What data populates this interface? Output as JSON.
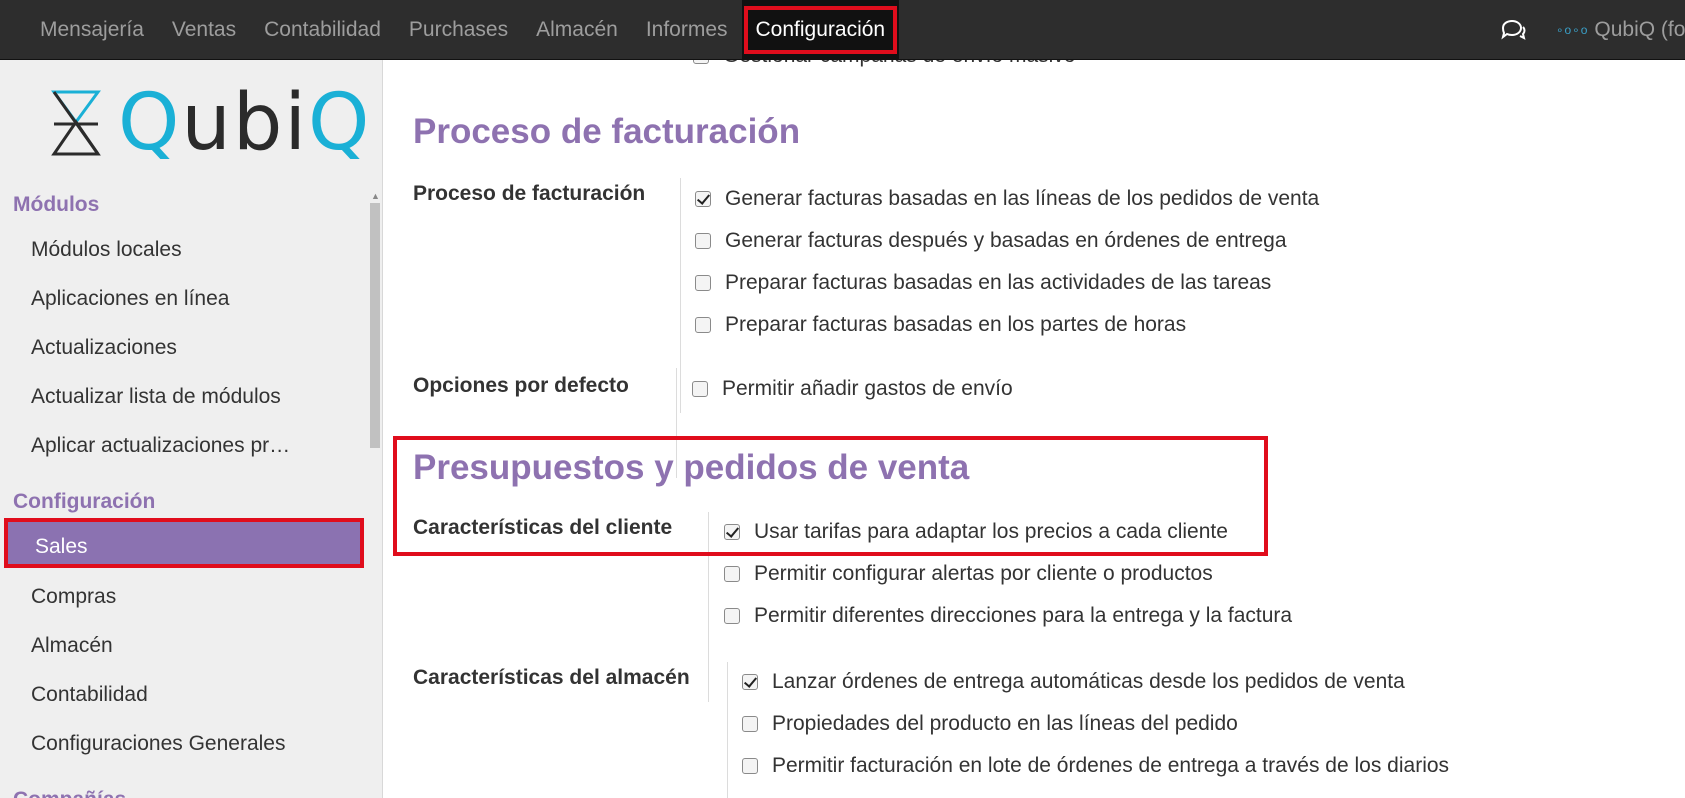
{
  "topbar": {
    "menu": [
      "Mensajería",
      "Ventas",
      "Contabilidad",
      "Purchases",
      "Almacén",
      "Informes",
      "Configuración"
    ],
    "active_index": 6,
    "user_name": "QubiQ (fo",
    "user_dots": "∘o∘o"
  },
  "sidebar": {
    "logo_text": "QubiQ",
    "sections": [
      {
        "title": "Módulos",
        "items": [
          "Módulos locales",
          "Aplicaciones en línea",
          "Actualizaciones",
          "Actualizar lista de módulos",
          "Aplicar actualizaciones pr…"
        ]
      },
      {
        "title": "Configuración",
        "items": [
          "Sales",
          "Compras",
          "Almacén",
          "Contabilidad",
          "Configuraciones Generales"
        ]
      },
      {
        "title": "Compañías",
        "items": []
      }
    ],
    "active_item": "Sales"
  },
  "main": {
    "top_cut_text": "Gestionar campañas de envío masivo",
    "sections": [
      {
        "title": "Proceso de facturación",
        "groups": [
          {
            "label": "Proceso de facturación",
            "options": [
              {
                "text": "Generar facturas basadas en las líneas de los pedidos de venta",
                "checked": true
              },
              {
                "text": "Generar facturas después y basadas en órdenes de entrega",
                "checked": false
              },
              {
                "text": "Preparar facturas basadas en las actividades de las tareas",
                "checked": false
              },
              {
                "text": "Preparar facturas basadas en los partes de horas",
                "checked": false
              }
            ]
          },
          {
            "label": "Opciones por defecto",
            "options": [
              {
                "text": "Permitir añadir gastos de envío",
                "checked": false
              }
            ]
          }
        ]
      },
      {
        "title": "Presupuestos y pedidos de venta",
        "groups": [
          {
            "label": "Características del cliente",
            "options": [
              {
                "text": "Usar tarifas para adaptar los precios a cada cliente",
                "checked": true
              },
              {
                "text": "Permitir configurar alertas por cliente o productos",
                "checked": false
              },
              {
                "text": "Permitir diferentes direcciones para la entrega y la factura",
                "checked": false
              }
            ]
          },
          {
            "label": "Características del almacén",
            "options": [
              {
                "text": "Lanzar órdenes de entrega automáticas desde los pedidos de venta",
                "checked": true
              },
              {
                "text": "Propiedades del producto en las líneas del pedido",
                "checked": false
              },
              {
                "text": "Permitir facturación en lote de órdenes de entrega a través de los diarios",
                "checked": false
              }
            ]
          }
        ]
      }
    ]
  },
  "colors": {
    "topbar_bg": "#2d2d2d",
    "accent_purple": "#8e72b0",
    "highlight_red": "#e00d1c",
    "logo_cyan": "#1ab0d6"
  }
}
